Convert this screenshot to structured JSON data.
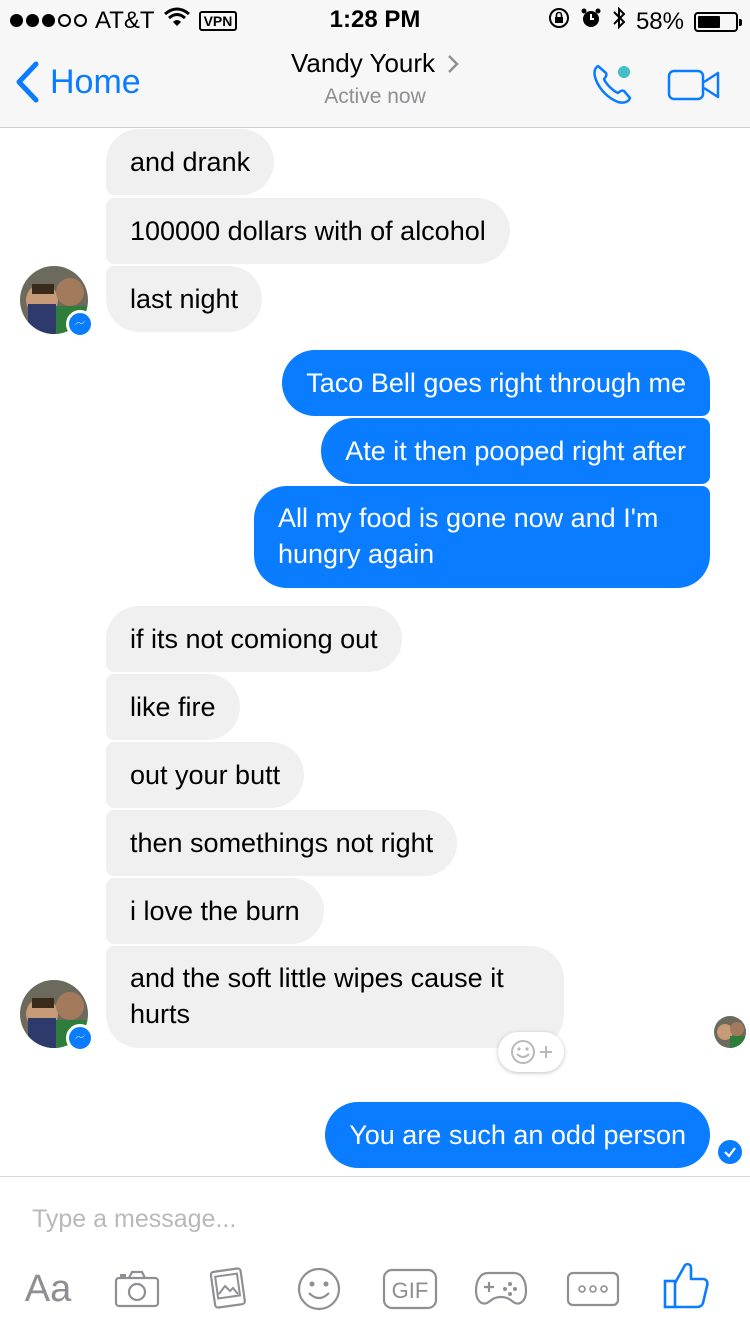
{
  "status_bar": {
    "carrier": "AT&T",
    "vpn": "VPN",
    "time": "1:28 PM",
    "battery": "58%",
    "battery_level": 0.58
  },
  "header": {
    "back_label": "Home",
    "contact_name": "Vandy Yourk",
    "presence": "Active now",
    "colors": {
      "accent": "#0a7cff",
      "presence_dot": "#44bec7"
    }
  },
  "messages": [
    {
      "from": "them",
      "text": "and drank"
    },
    {
      "from": "them",
      "text": "100000 dollars with of alcohol"
    },
    {
      "from": "them",
      "text": "last night"
    },
    {
      "from": "me",
      "text": "Taco Bell goes right through me"
    },
    {
      "from": "me",
      "text": "Ate it then pooped right after"
    },
    {
      "from": "me",
      "text": "All my food is gone now and I'm hungry again"
    },
    {
      "from": "them",
      "text": "if its not comiong out"
    },
    {
      "from": "them",
      "text": "like fire"
    },
    {
      "from": "them",
      "text": "out your butt"
    },
    {
      "from": "them",
      "text": "then somethings not right"
    },
    {
      "from": "them",
      "text": "i love the burn"
    },
    {
      "from": "them",
      "text": "and the soft little wipes cause it hurts"
    },
    {
      "from": "me",
      "text": "You are such an odd person"
    }
  ],
  "composer": {
    "placeholder": "Type a message...",
    "value": "",
    "text_button": "Aa",
    "gif_label": "GIF",
    "toolbar_icons": [
      "camera-icon",
      "photo-icon",
      "emoji-icon",
      "gif-icon",
      "game-icon",
      "more-icon",
      "thumbs-up-icon"
    ]
  }
}
